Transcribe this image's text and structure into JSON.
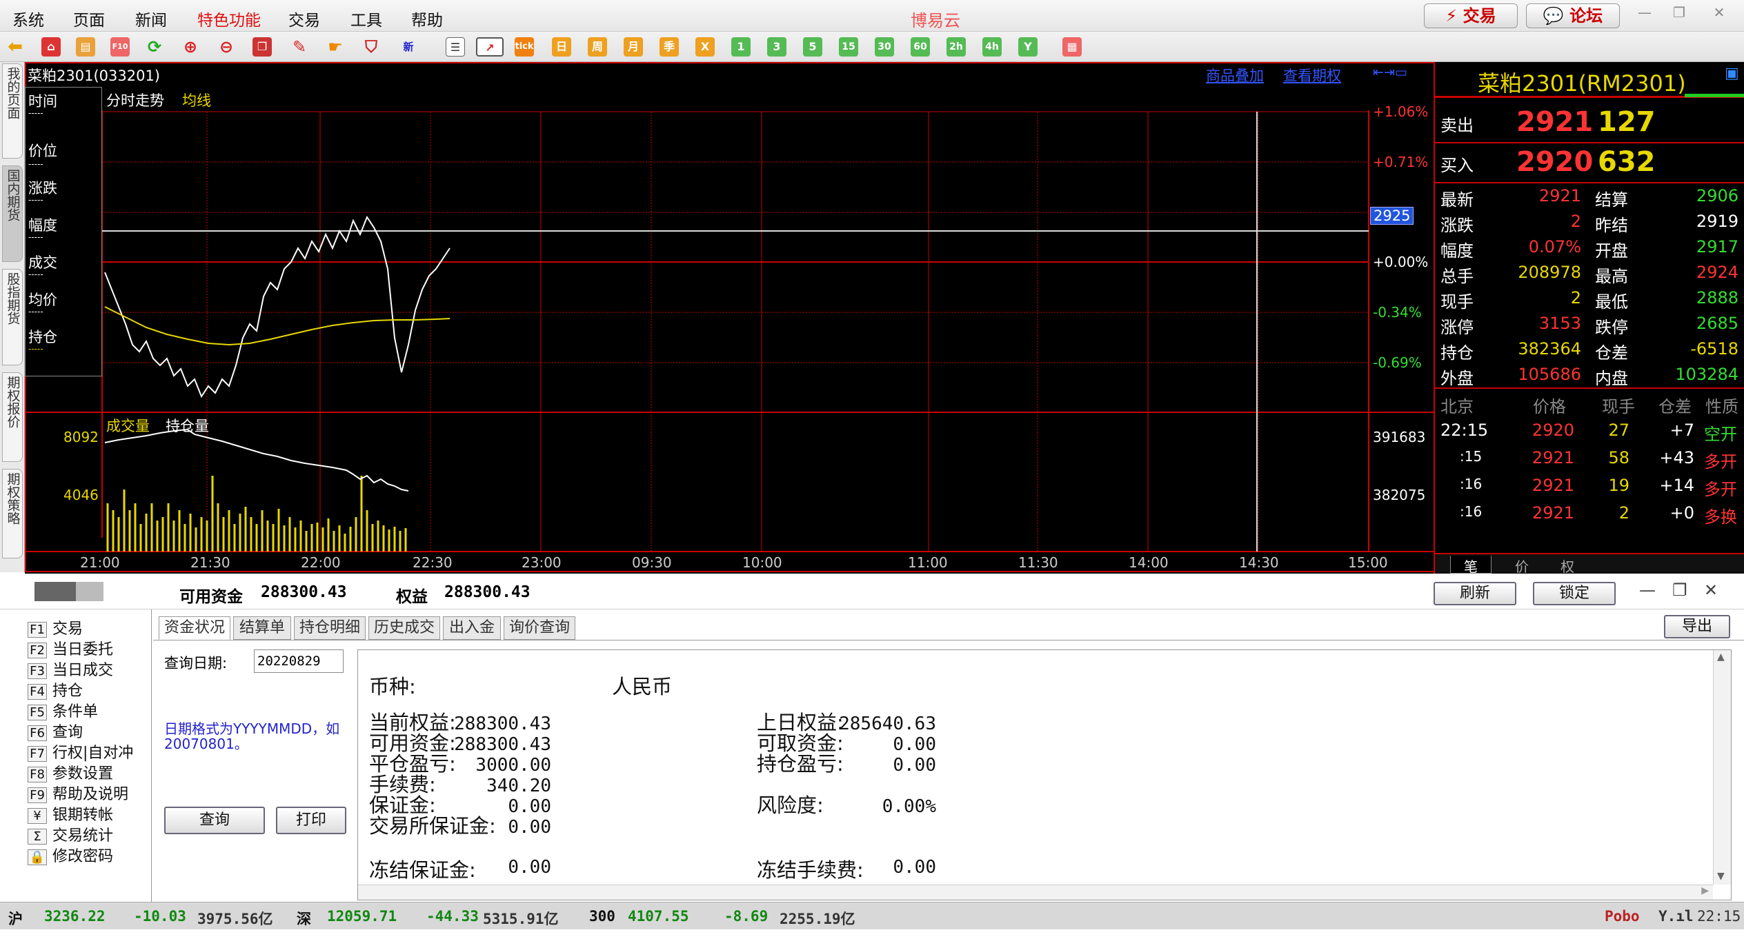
{
  "menu": [
    "系统",
    "页面",
    "新闻",
    "特色功能",
    "交易",
    "工具",
    "帮助"
  ],
  "app_title": "博易云",
  "top_buttons": {
    "trade": "⚡ 交易",
    "forum": "💬 论坛"
  },
  "toolbar": {
    "tick_label": "tick",
    "periods": [
      "日",
      "周",
      "月",
      "季",
      "X",
      "1",
      "3",
      "5",
      "15",
      "30",
      "60",
      "2h",
      "4h",
      "Y"
    ],
    "new_label": "新"
  },
  "vtabs": [
    "我的页面",
    "国内期货",
    "股指期货",
    "期权报价",
    "期权策略"
  ],
  "chart": {
    "title": "菜粕2301(033201)",
    "links": [
      "商品叠加",
      "查看期权"
    ],
    "mode_label": "分时走势",
    "avg_label": "均线",
    "info_labels": [
      "时间",
      "价位",
      "涨跌",
      "幅度",
      "成交",
      "均价",
      "持仓"
    ],
    "info_values": [
      "-----",
      "-----",
      "-----",
      "-----",
      "-----",
      "-----",
      "-----"
    ],
    "pct_labels": [
      "+1.06%",
      "+0.71%",
      "+0.00%",
      "-0.34%",
      "-0.69%"
    ],
    "cursor_price": "2925",
    "volume_label": "成交量",
    "oi_label": "持仓量",
    "volume_ticks": [
      "8092",
      "4046"
    ],
    "oi_ticks": [
      "391683",
      "382075"
    ],
    "time_labels": [
      "21:00",
      "21:30",
      "22:00",
      "22:30",
      "23:00",
      "09:30",
      "10:00",
      "11:00",
      "11:30",
      "14:00",
      "14:30",
      "15:00"
    ]
  },
  "quote": {
    "title": "菜粕2301(RM2301)",
    "sell_label": "卖出",
    "sell_price": "2921",
    "sell_vol": "127",
    "buy_label": "买入",
    "buy_price": "2920",
    "buy_vol": "632",
    "rows": [
      {
        "l1": "最新",
        "v1": "2921",
        "l2": "结算",
        "v2": "2906"
      },
      {
        "l1": "涨跌",
        "v1": "2",
        "l2": "昨结",
        "v2": "2919"
      },
      {
        "l1": "幅度",
        "v1": "0.07%",
        "l2": "开盘",
        "v2": "2917"
      },
      {
        "l1": "总手",
        "v1": "208978",
        "l2": "最高",
        "v2": "2924"
      },
      {
        "l1": "现手",
        "v1": "2",
        "l2": "最低",
        "v2": "2888"
      },
      {
        "l1": "涨停",
        "v1": "3153",
        "l2": "跌停",
        "v2": "2685"
      },
      {
        "l1": "持仓",
        "v1": "382364",
        "l2": "仓差",
        "v2": "-6518"
      },
      {
        "l1": "外盘",
        "v1": "105686",
        "l2": "内盘",
        "v2": "103284"
      }
    ],
    "tick_headers": [
      "北京",
      "价格",
      "现手",
      "仓差",
      "性质"
    ],
    "ticks": [
      {
        "time": "22:15",
        "price": "2920",
        "vol": "27",
        "diff": "+7",
        "type": "空开"
      },
      {
        "time": ":15",
        "price": "2921",
        "vol": "58",
        "diff": "+43",
        "type": "多开"
      },
      {
        "time": ":16",
        "price": "2921",
        "vol": "19",
        "diff": "+14",
        "type": "多开"
      },
      {
        "time": ":16",
        "price": "2921",
        "vol": "2",
        "diff": "+0",
        "type": "多换"
      }
    ],
    "bottom_tabs": [
      "笔",
      "价",
      "权"
    ]
  },
  "trade": {
    "available_label": "可用资金",
    "available": "288300.43",
    "equity_label": "权益",
    "equity": "288300.43",
    "refresh": "刷新",
    "lock": "锁定",
    "export": "导出",
    "tree": [
      {
        "key": "F1",
        "label": "交易"
      },
      {
        "key": "F2",
        "label": "当日委托"
      },
      {
        "key": "F3",
        "label": "当日成交"
      },
      {
        "key": "F4",
        "label": "持仓"
      },
      {
        "key": "F5",
        "label": "条件单"
      },
      {
        "key": "F6",
        "label": "查询"
      },
      {
        "key": "F7",
        "label": "行权|自对冲"
      },
      {
        "key": "F8",
        "label": "参数设置"
      },
      {
        "key": "F9",
        "label": "帮助及说明"
      },
      {
        "key": "¥",
        "label": "银期转帐"
      },
      {
        "key": "Σ",
        "label": "交易统计"
      },
      {
        "key": "🔒",
        "label": "修改密码"
      }
    ],
    "tabs": [
      "资金状况",
      "结算单",
      "持仓明细",
      "历史成交",
      "出入金",
      "询价查询"
    ],
    "query_date_label": "查询日期:",
    "query_date_value": "20220829",
    "date_hint": "日期格式为YYYYMMDD，如20070801。",
    "query_btn": "查询",
    "print_btn": "打印",
    "currency_label": "币种:",
    "currency": "人民币",
    "fund_left": [
      {
        "label": "当前权益:",
        "value": "288300.43"
      },
      {
        "label": "可用资金:",
        "value": "288300.43"
      },
      {
        "label": "平仓盈亏:",
        "value": "3000.00"
      },
      {
        "label": "手续费:",
        "value": "340.20"
      },
      {
        "label": "保证金:",
        "value": "0.00"
      },
      {
        "label": "交易所保证金:",
        "value": "0.00"
      }
    ],
    "fund_right": [
      {
        "label": "上日权益:",
        "value": "285640.63"
      },
      {
        "label": "可取资金:",
        "value": "0.00"
      },
      {
        "label": "持仓盈亏:",
        "value": "0.00"
      },
      {
        "label": "风险度:",
        "value": "0.00%"
      }
    ],
    "frozen_margin_label": "冻结保证金:",
    "frozen_margin": "0.00",
    "frozen_fee_label": "冻结手续费:",
    "frozen_fee": "0.00"
  },
  "status": {
    "sh": "沪",
    "sh_idx": "3236.22",
    "sh_chg": "-10.03",
    "sh_amt": "3975.56亿",
    "sz": "深",
    "sz_idx": "12059.71",
    "sz_chg": "-44.33",
    "sz_amt": "5315.91亿",
    "c300": "300",
    "c300_idx": "4107.55",
    "c300_chg": "-8.69",
    "c300_amt": "2255.19亿",
    "brand": "Pobo",
    "time": "22:15"
  }
}
